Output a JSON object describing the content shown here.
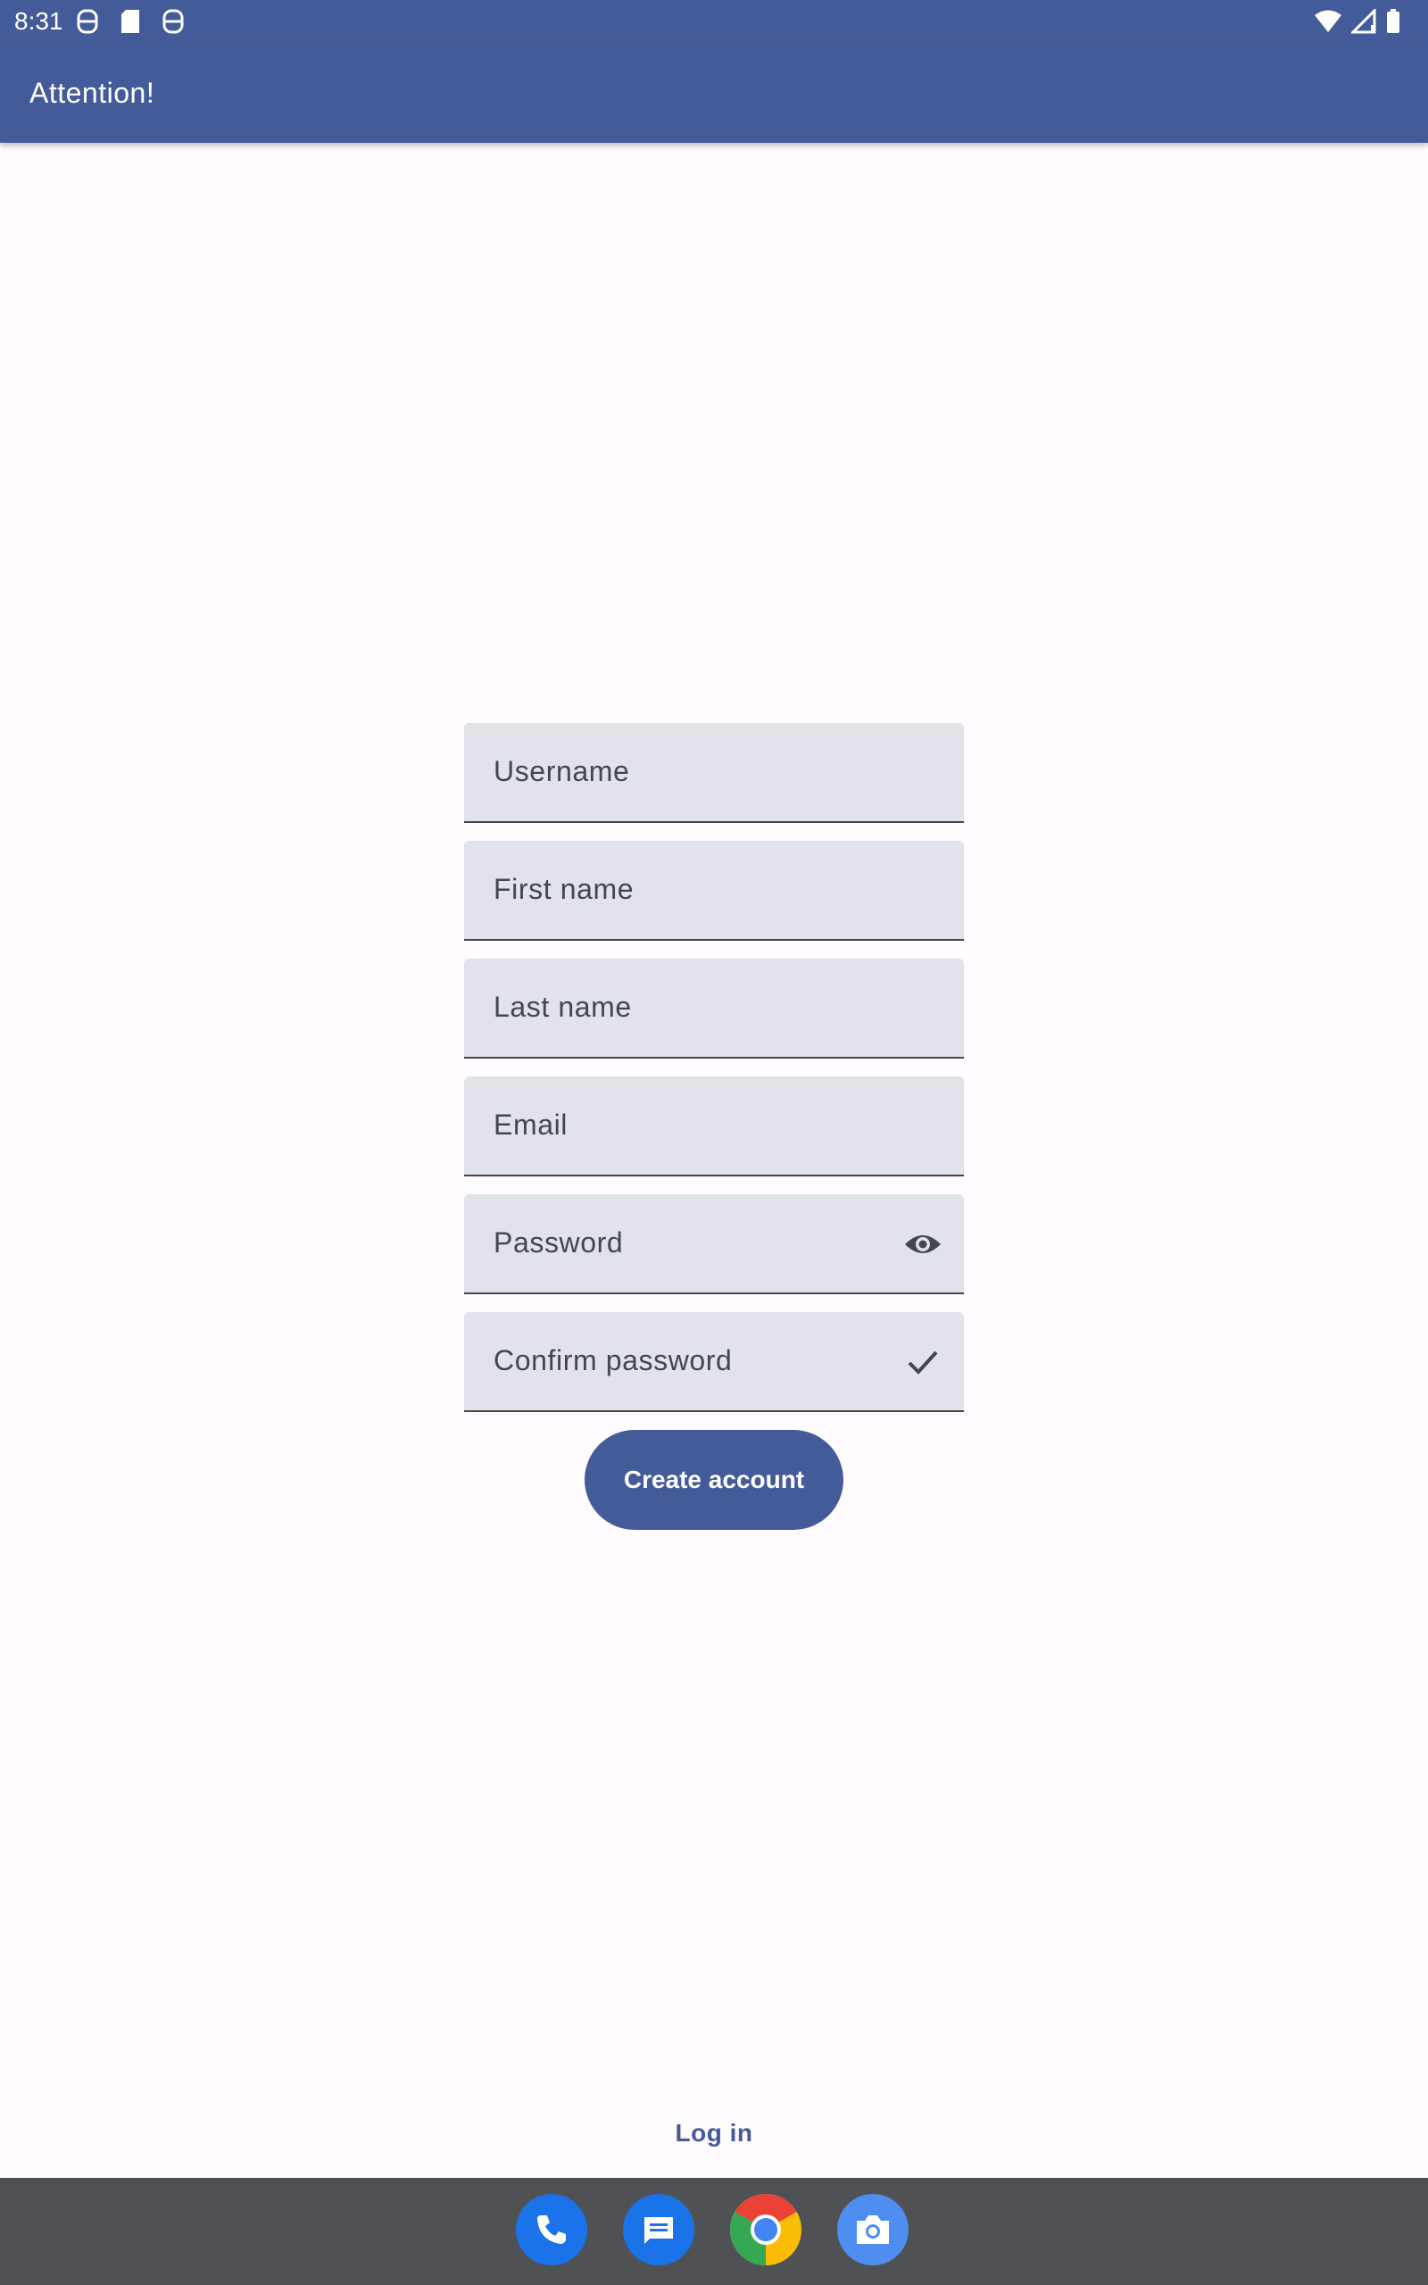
{
  "status_bar": {
    "time": "8:31",
    "left_icons": [
      "notification-icon",
      "sd-card-icon",
      "notification-icon"
    ],
    "right_icons": [
      "wifi-icon",
      "cellular-signal-icon",
      "battery-icon"
    ]
  },
  "app_bar": {
    "title": "Attention!"
  },
  "form": {
    "fields": [
      {
        "label": "Username"
      },
      {
        "label": "First name"
      },
      {
        "label": "Last name"
      },
      {
        "label": "Email"
      },
      {
        "label": "Password",
        "trailing_icon": "visibility-eye-icon"
      },
      {
        "label": "Confirm password",
        "trailing_icon": "checkmark-icon"
      }
    ],
    "submit_label": "Create account"
  },
  "login_link": "Log in",
  "dock": {
    "apps": [
      "phone-app-icon",
      "messages-app-icon",
      "chrome-app-icon",
      "camera-app-icon"
    ]
  },
  "colors": {
    "primary": "#445b99",
    "field_background": "#e1e2ea",
    "background": "#fffbfe",
    "nav_bar": "#505154"
  }
}
